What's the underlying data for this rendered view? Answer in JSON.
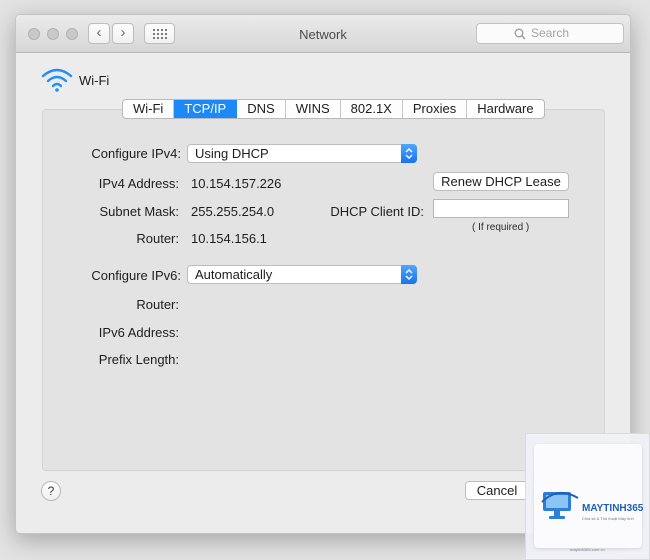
{
  "window": {
    "title": "Network",
    "search_placeholder": "Search",
    "nav_back": "‹",
    "nav_forward": "›"
  },
  "interface": {
    "name": "Wi-Fi",
    "icon": "wifi-icon"
  },
  "tabs": [
    {
      "label": "Wi-Fi",
      "active": false
    },
    {
      "label": "TCP/IP",
      "active": true
    },
    {
      "label": "DNS",
      "active": false
    },
    {
      "label": "WINS",
      "active": false
    },
    {
      "label": "802.1X",
      "active": false
    },
    {
      "label": "Proxies",
      "active": false
    },
    {
      "label": "Hardware",
      "active": false
    }
  ],
  "ipv4": {
    "configure_label": "Configure IPv4:",
    "configure_value": "Using DHCP",
    "address_label": "IPv4 Address:",
    "address_value": "10.154.157.226",
    "subnet_label": "Subnet Mask:",
    "subnet_value": "255.255.254.0",
    "router_label": "Router:",
    "router_value": "10.154.156.1",
    "renew_button": "Renew DHCP Lease",
    "client_id_label": "DHCP Client ID:",
    "client_id_value": "",
    "client_id_note": "( If required )"
  },
  "ipv6": {
    "configure_label": "Configure IPv6:",
    "configure_value": "Automatically",
    "router_label": "Router:",
    "address_label": "IPv6 Address:",
    "prefix_label": "Prefix Length:"
  },
  "footer": {
    "help_label": "?",
    "cancel_button": "Cancel"
  },
  "watermark": {
    "brand": "MAYTINH365",
    "tagline": "Chia sẻ & Thủ thuật Máy tính",
    "url": "maytinh365.com.vn"
  },
  "colors": {
    "accent": "#1d88f8",
    "window_bg": "#ececec",
    "panel_bg": "#e3e3e3"
  }
}
